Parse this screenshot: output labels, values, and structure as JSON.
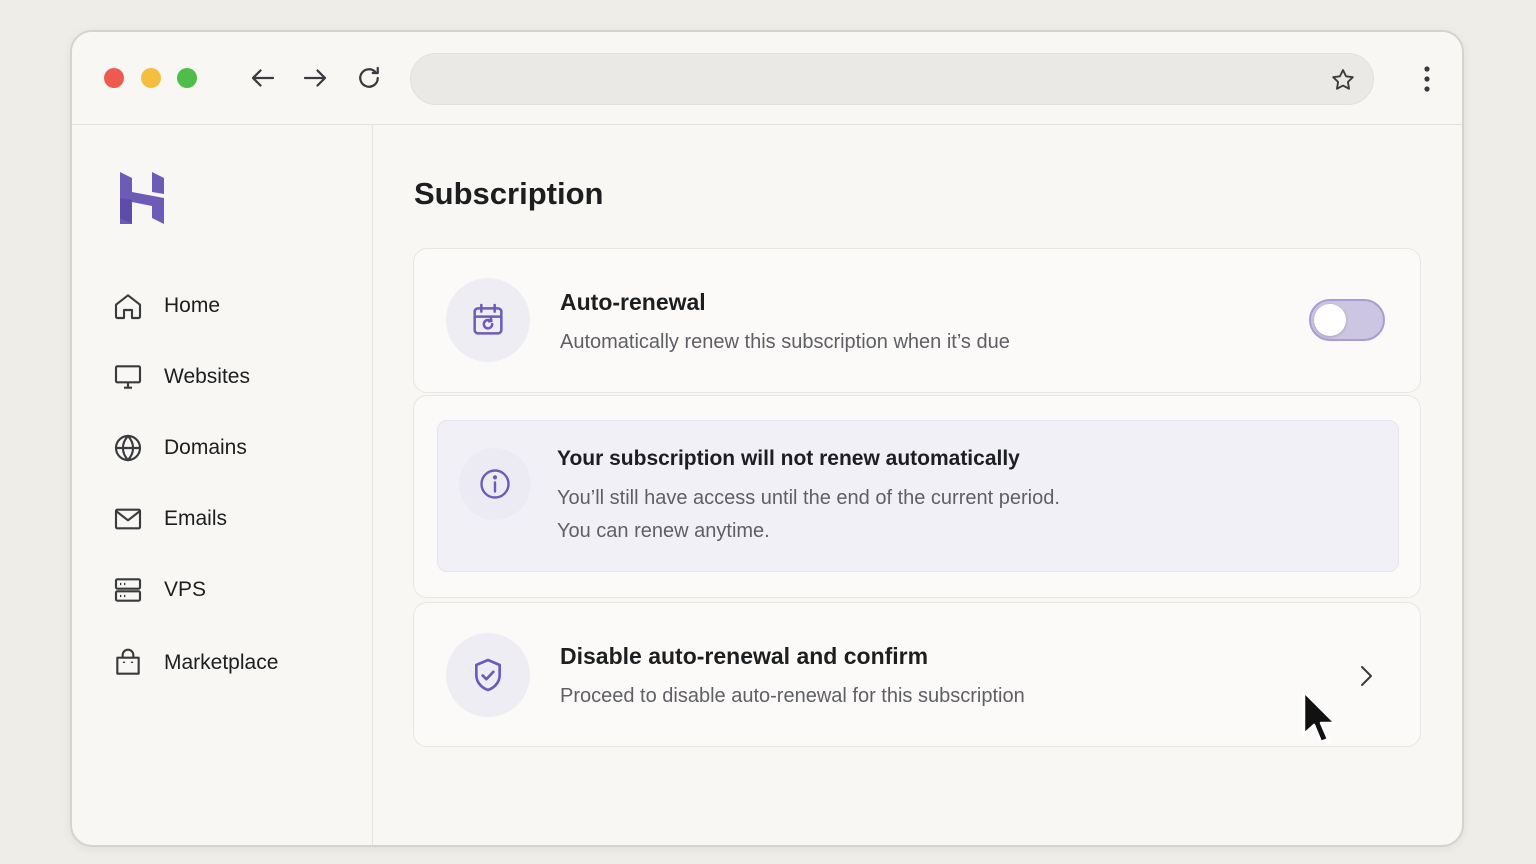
{
  "browser": {
    "traffic_lights": {
      "close": "#ee5a4f",
      "minimize": "#f5bf3e",
      "maximize": "#4fbd4a"
    },
    "nav_icons": [
      "back-arrow-icon",
      "forward-arrow-icon",
      "reload-icon"
    ],
    "address_value": "",
    "right_icons": [
      "star-icon",
      "more-vertical-icon"
    ]
  },
  "brand": {
    "logo": "hostinger-logo",
    "accent": "#6c5bb7"
  },
  "sidebar": {
    "items": [
      {
        "label": "Home",
        "icon": "home-icon"
      },
      {
        "label": "Websites",
        "icon": "monitor-icon"
      },
      {
        "label": "Domains",
        "icon": "globe-icon"
      },
      {
        "label": "Emails",
        "icon": "mail-icon"
      },
      {
        "label": "VPS",
        "icon": "server-icon"
      },
      {
        "label": "Marketplace",
        "icon": "shopping-bag-icon"
      }
    ]
  },
  "main": {
    "title": "Subscription",
    "auto_renewal": {
      "icon": "calendar-refresh-icon",
      "title": "Auto-renewal",
      "description": "Automatically renew this subscription when it’s due",
      "toggle_on": false
    },
    "notice": {
      "icon": "info-icon",
      "title": "Your subscription will not renew automatically",
      "line1": "You’ll still have access until the end of the current period.",
      "line2": "You can renew anytime."
    },
    "disable_action": {
      "icon": "shield-check-icon",
      "title": "Disable auto-renewal and confirm",
      "description": "Proceed to disable auto-renewal for this subscription",
      "chevron": "chevron-right-icon"
    }
  }
}
